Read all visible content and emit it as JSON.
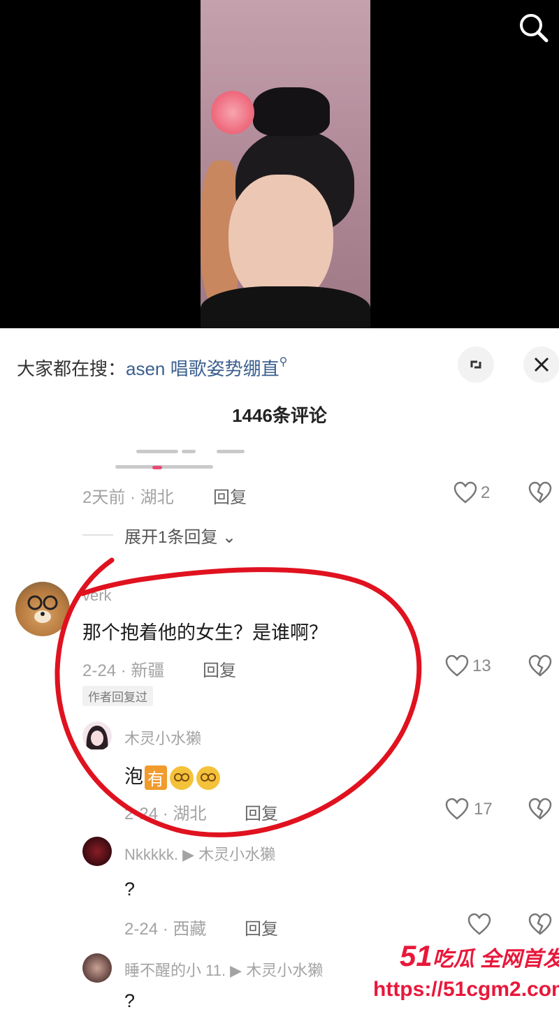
{
  "video": {
    "search_icon": "search-icon"
  },
  "hot_search": {
    "prefix": "大家都在搜：",
    "query": "asen 唱歌姿势绷直",
    "expand_icon": "expand-icon",
    "close_icon": "close-icon"
  },
  "comment_count": "1446条评论",
  "comments": [
    {
      "time_location": "2天前 · 湖北",
      "reply_label": "回复",
      "likes": "2"
    },
    {
      "username": "verk",
      "text": "那个抱着他的女生？是谁啊？",
      "time_location": "2-24 · 新疆",
      "reply_label": "回复",
      "likes": "13",
      "author_tag": "作者回复过"
    }
  ],
  "expand_replies": "展开1条回复",
  "replies": [
    {
      "username": "木灵小水獭",
      "text": "泡",
      "tag": "有",
      "time_location": "2-24 · 湖北",
      "reply_label": "回复",
      "likes": "17"
    },
    {
      "username": "Nkkkkk. ▶ 木灵小水獭",
      "text": "?",
      "time_location": "2-24 · 西藏",
      "reply_label": "回复",
      "likes": ""
    },
    {
      "username": "睡不醒的小 11. ▶ 木灵小水獭",
      "text": "?"
    }
  ],
  "watermark": {
    "number": "51",
    "text": "吃瓜 全网首发",
    "url": "https://51cgm2.com"
  },
  "colors": {
    "accent_link": "#3b5f8f",
    "watermark": "#e8183b",
    "annotation": "#e0121f"
  }
}
